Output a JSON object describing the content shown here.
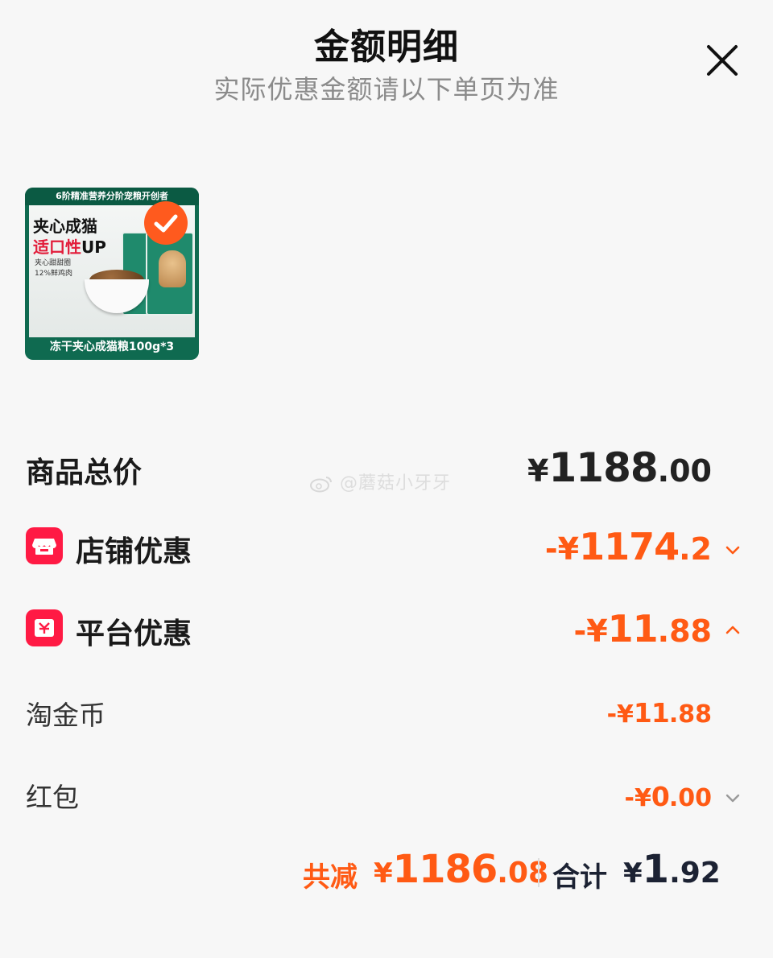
{
  "header": {
    "title": "金额明细",
    "subtitle": "实际优惠金额请以下单页为准"
  },
  "product": {
    "thumb_top_text": "6阶精准营养分阶宠粮开创者",
    "thumb_headline_1": "夹心成猫",
    "thumb_headline_2": "适口性",
    "thumb_headline_2_suffix": "UP",
    "thumb_line_1": "夹心甜甜圈",
    "thumb_line_2": "12%鲜鸡肉",
    "thumb_bottom_text": "冻干夹心成猫粮100g*3",
    "selected": true
  },
  "watermark": "@蘑菇小牙牙",
  "rows": {
    "total": {
      "label": "商品总价",
      "currency": "¥",
      "int": "1188",
      "dec": ".00"
    },
    "shop": {
      "label": "店铺优惠",
      "prefix": "-¥",
      "int": "1174",
      "dec": ".2",
      "icon": "shop-icon",
      "expanded": false
    },
    "platform": {
      "label": "平台优惠",
      "prefix": "-¥",
      "int": "11",
      "dec": ".88",
      "icon": "platform-coupon-icon",
      "expanded": true
    },
    "coin": {
      "label": "淘金币",
      "prefix": "-¥",
      "int": "11",
      "dec": ".88"
    },
    "redpacket": {
      "label": "红包",
      "prefix": "-¥",
      "int": "0",
      "dec": ".00",
      "expanded": false
    }
  },
  "summary": {
    "reduce_label": "共减",
    "reduce_currency": "¥",
    "reduce_int": "1186",
    "reduce_dec": ".08",
    "total_label": "合计",
    "total_currency": "¥",
    "total_int": "1",
    "total_dec": ".92"
  },
  "colors": {
    "accent": "#ff5a14",
    "icon_red": "#ff1a44",
    "check": "#ff5a1e",
    "text": "#1a1a1a",
    "muted": "#8b8b8b"
  }
}
